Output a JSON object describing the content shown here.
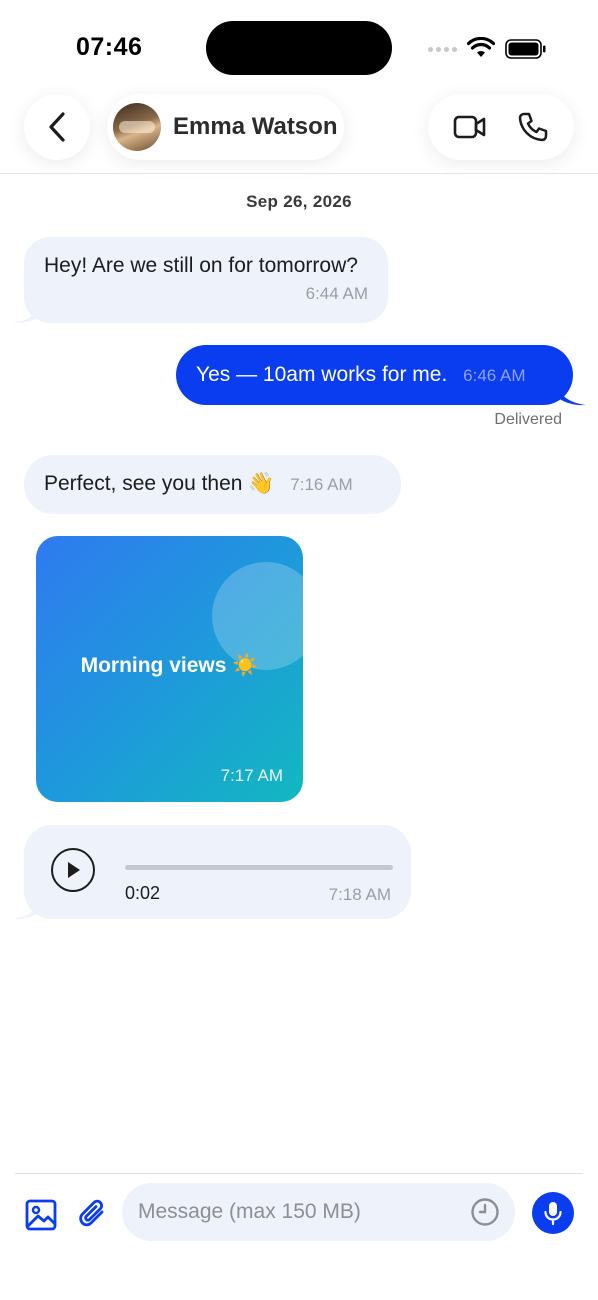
{
  "status_bar": {
    "time": "07:46"
  },
  "header": {
    "contact_name": "Emma Watson"
  },
  "chat": {
    "date_label": "Sep 26, 2026",
    "messages": [
      {
        "direction": "incoming",
        "text": "Hey! Are we still on for tomorrow?",
        "time": "6:44 AM"
      },
      {
        "direction": "outgoing",
        "text": "Yes — 10am works for me.",
        "time": "6:46 AM",
        "status": "Delivered"
      },
      {
        "direction": "incoming",
        "text": "Perfect, see you then 👋",
        "time": "7:16 AM"
      },
      {
        "direction": "incoming",
        "type": "media",
        "caption": "Morning views ☀️",
        "time": "7:17 AM"
      },
      {
        "direction": "incoming",
        "type": "voice",
        "duration": "0:02",
        "progress": 0,
        "time": "7:18 AM"
      }
    ]
  },
  "composer": {
    "placeholder": "Message (max 150 MB)",
    "value": ""
  },
  "colors": {
    "accent": "#0a3cf0",
    "incoming_bubble": "#edf2fb",
    "media_gradient_start": "#2f7af0",
    "media_gradient_end": "#12b8c0"
  },
  "icons": {
    "back": "chevron-left-icon",
    "video_call": "video-camera-icon",
    "voice_call": "phone-icon",
    "gallery": "image-icon",
    "attach": "paperclip-icon",
    "timer": "clock-icon",
    "mic": "microphone-icon",
    "play": "play-icon"
  }
}
